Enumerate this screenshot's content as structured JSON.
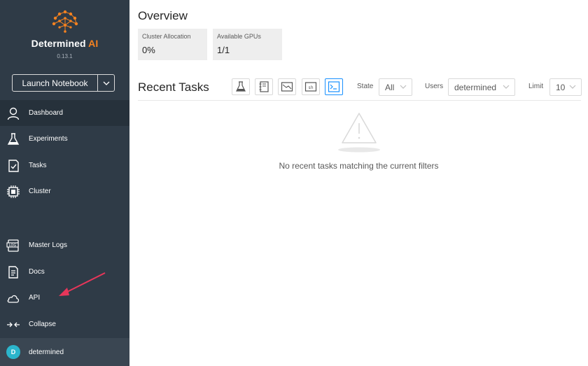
{
  "brand": {
    "name_main": "Determined ",
    "name_accent": "AI",
    "version": "0.13.1",
    "accent_color": "#f58220"
  },
  "launch": {
    "label": "Launch Notebook"
  },
  "nav": {
    "dashboard": "Dashboard",
    "experiments": "Experiments",
    "tasks": "Tasks",
    "cluster": "Cluster",
    "master_logs": "Master Logs",
    "docs": "Docs",
    "api": "API",
    "collapse": "Collapse"
  },
  "user": {
    "initial": "D",
    "name": "determined"
  },
  "overview": {
    "title": "Overview",
    "cards": [
      {
        "label": "Cluster Allocation",
        "value": "0%"
      },
      {
        "label": "Available GPUs",
        "value": "1/1"
      }
    ]
  },
  "recent_tasks": {
    "title": "Recent Tasks",
    "filters": {
      "state_label": "State",
      "state_value": "All",
      "users_label": "Users",
      "users_value": "determined",
      "limit_label": "Limit",
      "limit_value": "10"
    },
    "type_icons": [
      "experiment-icon",
      "notebook-icon",
      "tensorboard-icon",
      "shell-icon",
      "command-icon"
    ],
    "empty_message": "No recent tasks matching the current filters"
  }
}
